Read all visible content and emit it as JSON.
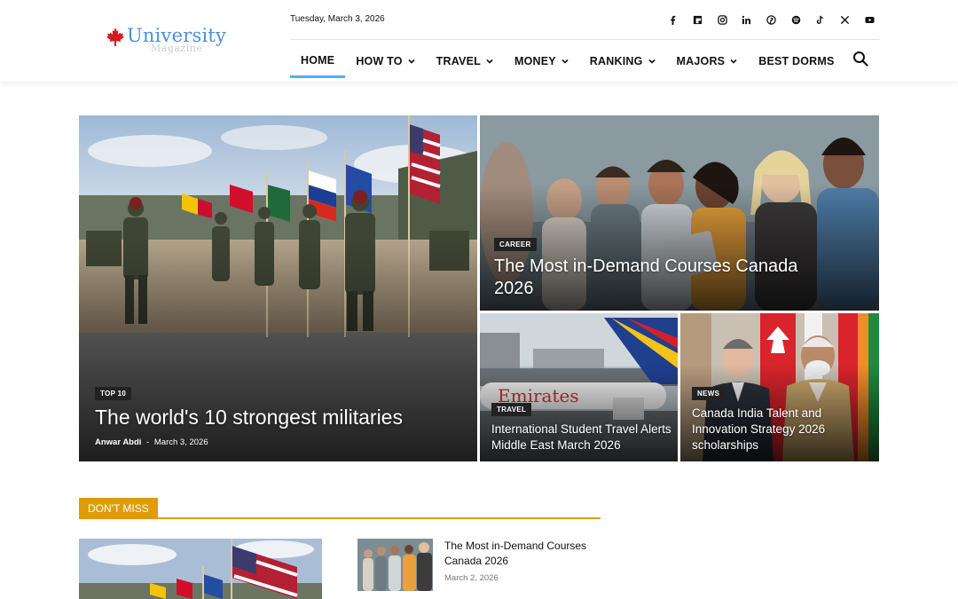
{
  "brand": {
    "name": "University",
    "subtitle": "Magazine",
    "accent": "#4a8fd6",
    "leaf_color": "#d71920"
  },
  "header": {
    "date": "Tuesday, March 3, 2026",
    "socials": [
      "facebook-icon",
      "flipboard-icon",
      "instagram-icon",
      "linkedin-icon",
      "pinterest-icon",
      "spotify-icon",
      "tiktok-icon",
      "x-icon",
      "youtube-icon"
    ]
  },
  "nav": {
    "items": [
      {
        "label": "HOME",
        "active": true,
        "dropdown": false
      },
      {
        "label": "HOW TO",
        "active": false,
        "dropdown": true
      },
      {
        "label": "TRAVEL",
        "active": false,
        "dropdown": true
      },
      {
        "label": "MONEY",
        "active": false,
        "dropdown": true
      },
      {
        "label": "RANKING",
        "active": false,
        "dropdown": true
      },
      {
        "label": "MAJORS",
        "active": false,
        "dropdown": true
      },
      {
        "label": "BEST DORMS",
        "active": false,
        "dropdown": false
      }
    ],
    "active_color": "#4db2ec"
  },
  "hero": {
    "main": {
      "category": "TOP 10",
      "title": "The world's 10 strongest militaries",
      "author": "Anwar Abdi",
      "separator": "-",
      "date": "March 3, 2026"
    },
    "top_right": {
      "category": "CAREER",
      "title": "The Most in-Demand Courses Canada 2026"
    },
    "bottom_left": {
      "category": "TRAVEL",
      "title": "International Student Travel Alerts Middle East March 2026",
      "plane_text": "Emirates"
    },
    "bottom_right": {
      "category": "NEWS",
      "title": "Canada India Talent and Innovation Strategy 2026 scholarships"
    }
  },
  "dont_miss": {
    "label": "DON'T MISS",
    "accent": "#e29b05",
    "side_article": {
      "title": "The Most in-Demand Courses Canada 2026",
      "date": "March 2, 2026"
    }
  }
}
